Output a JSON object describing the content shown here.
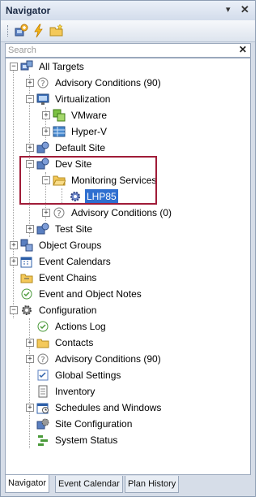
{
  "panel": {
    "title": "Navigator",
    "pin_icon": "pin-icon",
    "close_icon": "close-icon"
  },
  "toolbar": {
    "buttons": [
      "add-target-icon",
      "lightning-icon",
      "folder-new-icon"
    ]
  },
  "search": {
    "placeholder": "Search",
    "clear_icon": "clear-x-icon"
  },
  "tree": {
    "all_targets": "All Targets",
    "advisory_conditions_90": "Advisory Conditions (90)",
    "virtualization": "Virtualization",
    "vmware": "VMware",
    "hyperv": "Hyper-V",
    "default_site": "Default Site",
    "dev_site": "Dev Site",
    "monitoring_services": "Monitoring Services",
    "lhp85": "LHP85",
    "advisory_conditions_0": "Advisory Conditions (0)",
    "test_site": "Test Site",
    "object_groups": "Object Groups",
    "event_calendars": "Event Calendars",
    "event_chains": "Event Chains",
    "event_object_notes": "Event and Object Notes",
    "configuration": "Configuration",
    "actions_log": "Actions Log",
    "contacts": "Contacts",
    "advisory_conditions_cfg": "Advisory Conditions (90)",
    "global_settings": "Global Settings",
    "inventory": "Inventory",
    "schedules_windows": "Schedules and Windows",
    "site_configuration": "Site Configuration",
    "system_status": "System Status"
  },
  "selected": "LHP85",
  "tabs": [
    "Navigator",
    "Event Calendar",
    "Plan History"
  ],
  "active_tab": "Navigator",
  "colors": {
    "selection": "#2f6fd0",
    "highlight_box": "#a01c38",
    "frame": "#d6dde8"
  }
}
